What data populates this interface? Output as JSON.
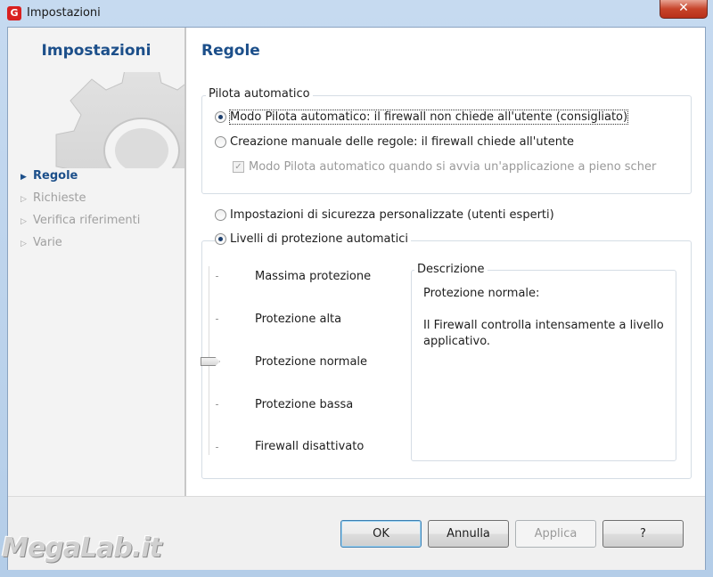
{
  "window": {
    "title": "Impostazioni",
    "close_label": "✕"
  },
  "sidebar": {
    "title": "Impostazioni",
    "items": [
      {
        "label": "Regole",
        "active": true
      },
      {
        "label": "Richieste",
        "active": false
      },
      {
        "label": "Verifica riferimenti",
        "active": false
      },
      {
        "label": "Varie",
        "active": false
      }
    ]
  },
  "main": {
    "title": "Regole",
    "pilot_group": {
      "legend": "Pilota automatico",
      "option_auto": "Modo Pilota automatico: il firewall non chiede all'utente (consigliato)",
      "option_manual": "Creazione manuale delle regole: il firewall chiede all'utente",
      "checkbox_fullscreen": "Modo Pilota automatico quando si avvia un'applicazione a pieno scher"
    },
    "custom_option": "Impostazioni di sicurezza personalizzate (utenti esperti)",
    "levels_option": "Livelli di protezione automatici",
    "levels": [
      "Massima protezione",
      "Protezione alta",
      "Protezione normale",
      "Protezione bassa",
      "Firewall disattivato"
    ],
    "selected_level": "Protezione normale",
    "description": {
      "legend": "Descrizione",
      "text": "Protezione normale:\n\nIl Firewall controlla intensamente a livello applicativo."
    }
  },
  "footer": {
    "ok": "OK",
    "cancel": "Annulla",
    "apply": "Applica",
    "help": "?"
  },
  "watermark": "MegaLab.it",
  "colors": {
    "heading": "#1c4f8a",
    "disabled": "#9a9a9a"
  }
}
